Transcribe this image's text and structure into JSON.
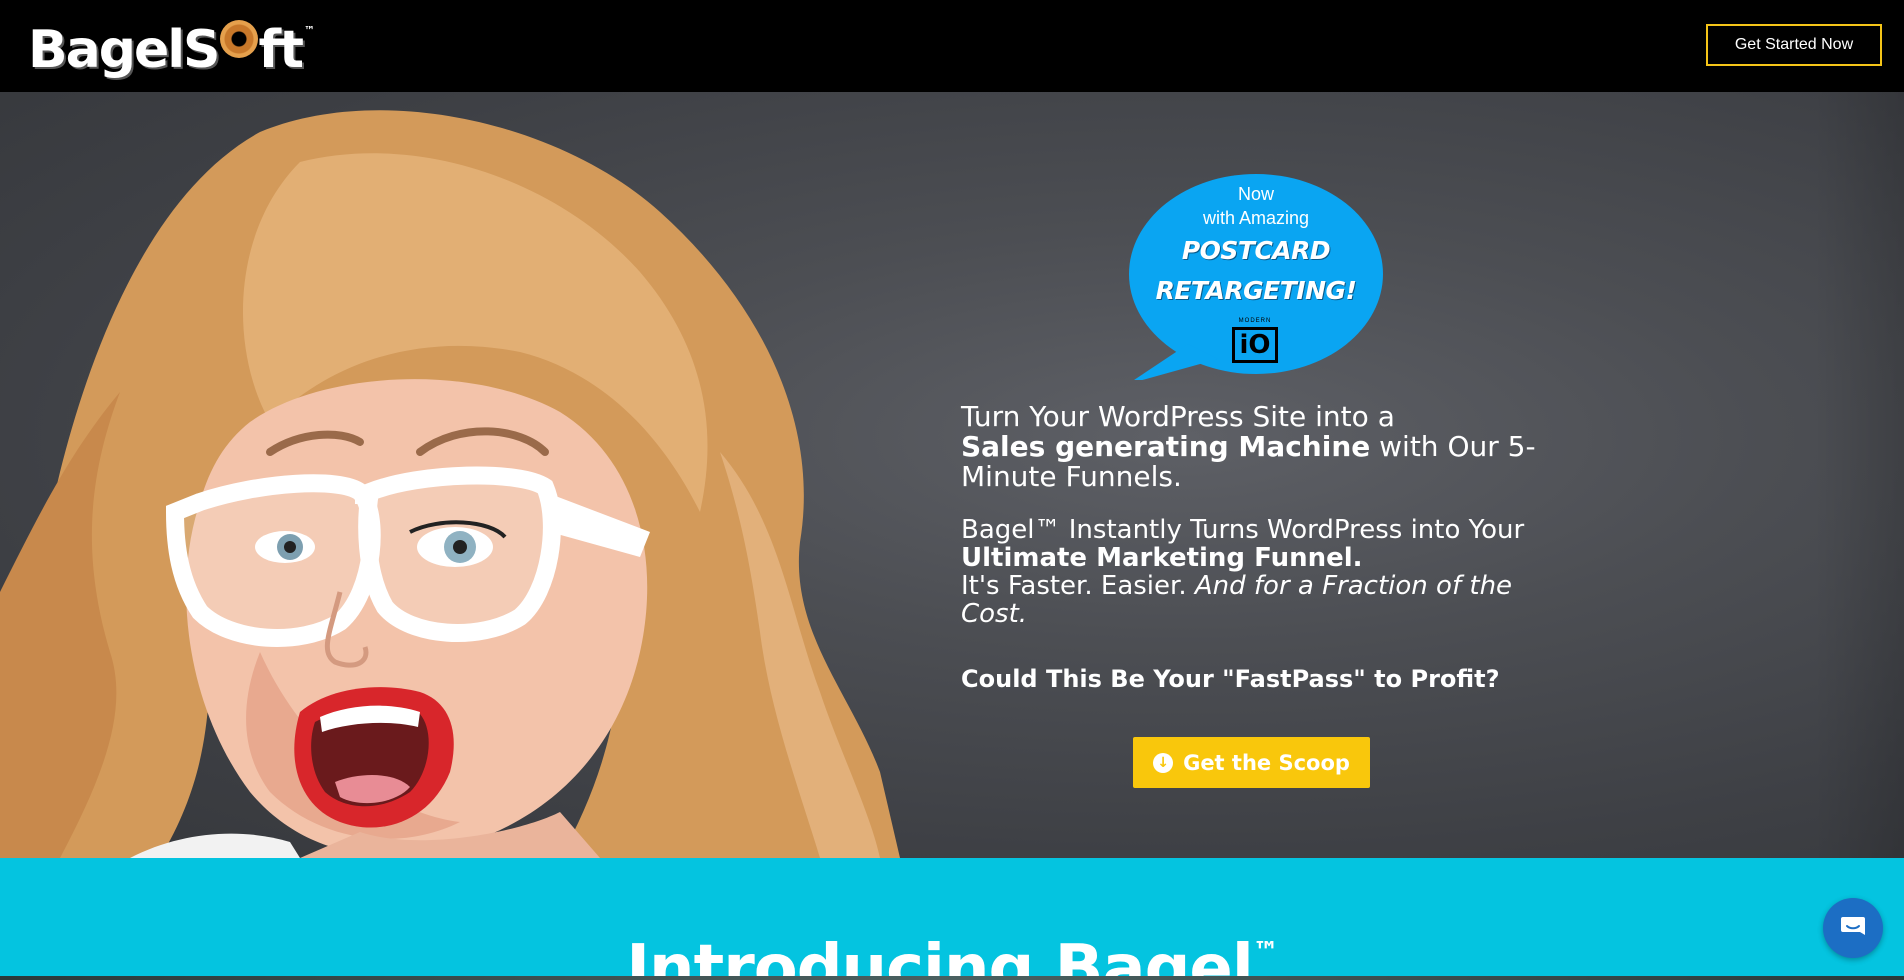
{
  "header": {
    "logo_text_1": "Bagel",
    "logo_text_2": "S",
    "logo_text_3": "ft",
    "logo_tm": "™",
    "cta_label": "Get Started Now"
  },
  "bubble": {
    "line1": "Now",
    "line2": "with Amazing",
    "line3": "POSTCARD",
    "line4": "RETARGETING!",
    "io_label": "MODERN",
    "io_text": "iO"
  },
  "hero": {
    "headline_1": "Turn Your WordPress Site into a",
    "headline_bold": "Sales generating Machine",
    "headline_2": " with Our 5-Minute Funnels.",
    "sub_1": "Bagel™ Instantly Turns WordPress into Your ",
    "sub_bold": "Ultimate Marketing Funnel.",
    "sub_2": "It's Faster. Easier. ",
    "sub_italic": "And for a Fraction of the Cost.",
    "question": "Could This Be Your \"FastPass\" to Profit?",
    "scoop_label": "Get the Scoop"
  },
  "intro": {
    "title": "Introducing Bagel",
    "tm": "™"
  },
  "colors": {
    "accent_yellow": "#f9c70c",
    "bubble_blue": "#0aa5f2",
    "intro_cyan": "#04c4e0",
    "chat_blue": "#1c6ec4"
  }
}
